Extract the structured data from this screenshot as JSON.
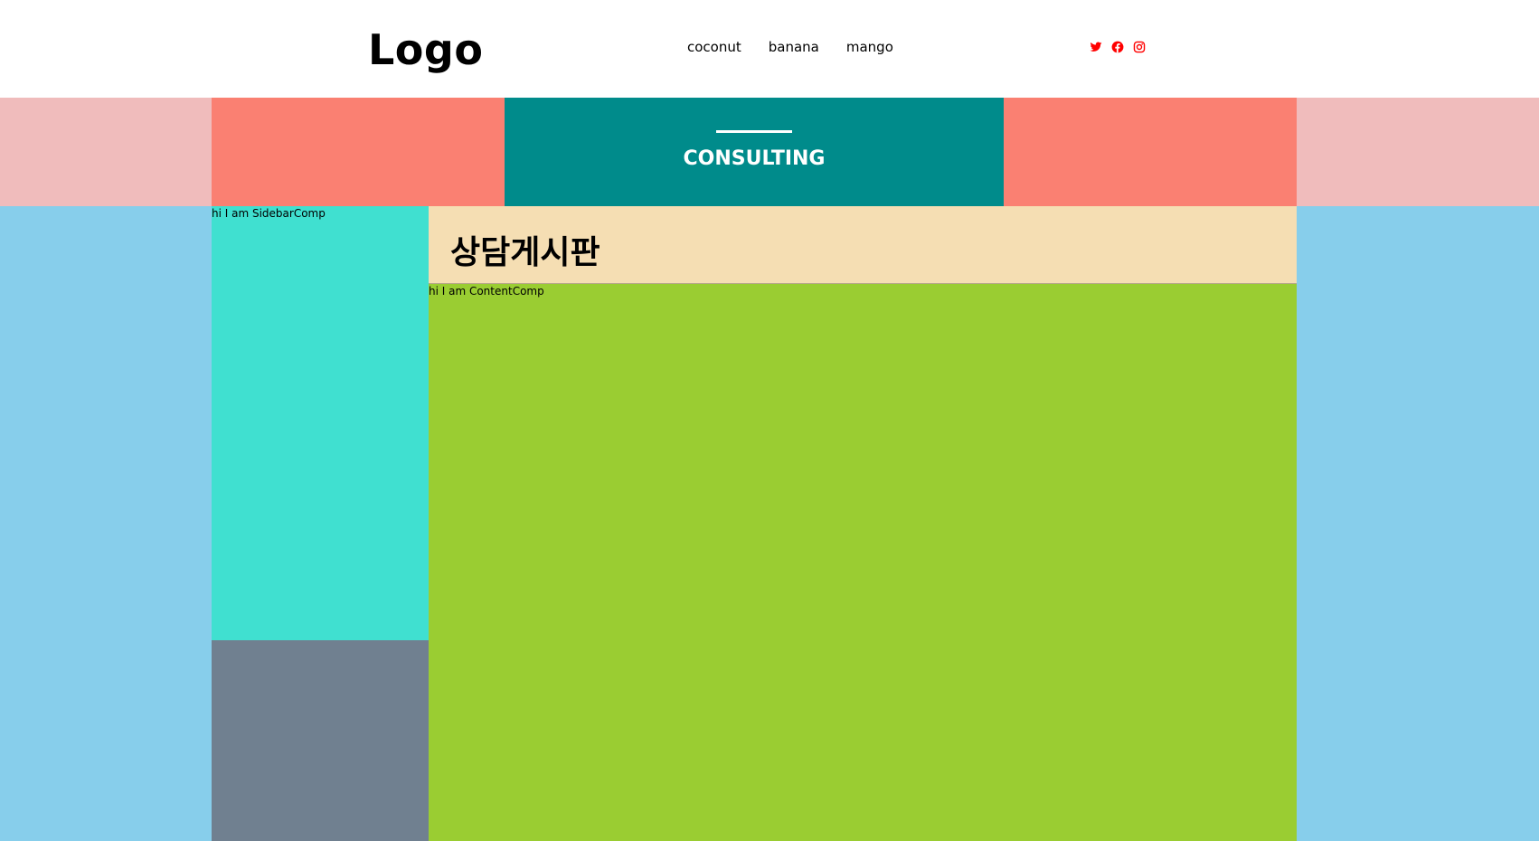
{
  "header": {
    "logo": "Logo",
    "nav": [
      {
        "label": "coconut"
      },
      {
        "label": "banana"
      },
      {
        "label": "mango"
      }
    ],
    "social": [
      {
        "icon": "twitter-icon",
        "color": "#ff0000"
      },
      {
        "icon": "facebook-icon",
        "color": "#ff0000"
      },
      {
        "icon": "instagram-icon",
        "color": "#ff0000"
      }
    ]
  },
  "banner": {
    "title": "CONSULTING"
  },
  "sidebar": {
    "text": "hi I am SidebarComp"
  },
  "content": {
    "title": "상담게시판",
    "text": "hi I am ContentComp"
  },
  "colors": {
    "banner_outer": "#f0bcbc",
    "banner_inner": "#fa8072",
    "banner_center": "#008b8b",
    "page_bg": "#87ceeb",
    "sidebar": "#40e0d0",
    "sidebar_bottom": "#708090",
    "content_header": "#f5deb3",
    "content": "#9acd32"
  }
}
